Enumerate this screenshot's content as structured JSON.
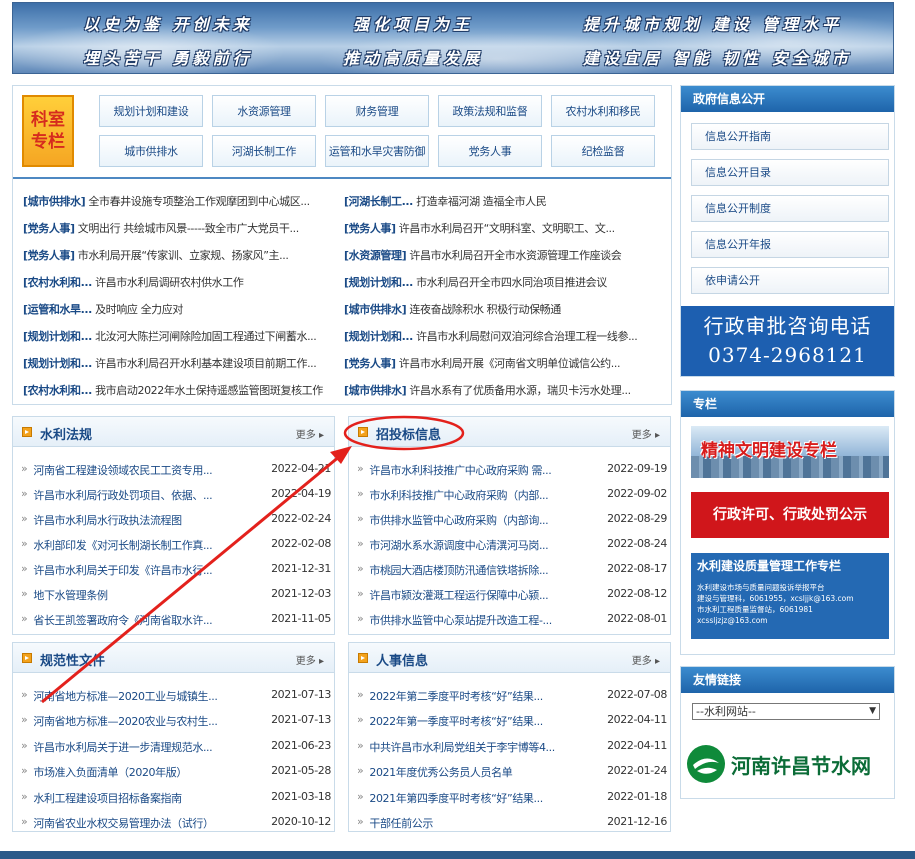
{
  "banner": {
    "slogans": [
      "以史为鉴 开创未来",
      "强化项目为王",
      "提升城市规划 建设 管理水平",
      "埋头苦干 勇毅前行",
      "推动高质量发展",
      "建设宜居 智能 韧性 安全城市"
    ]
  },
  "departments": {
    "badge": [
      "科室",
      "专栏"
    ],
    "buttons": [
      "规划计划和建设",
      "水资源管理",
      "财务管理",
      "政策法规和监督",
      "农村水利和移民",
      "城市供排水",
      "河湖长制工作",
      "运管和水旱灾害防御",
      "党务人事",
      "纪检监督"
    ]
  },
  "news": {
    "left": [
      {
        "cat": "[城市供排水]",
        "title": "全市春井设施专项整治工作观摩团到中心城区..."
      },
      {
        "cat": "[党务人事]",
        "title": "文明出行 共绘城市风景-----致全市广大党员干..."
      },
      {
        "cat": "[党务人事]",
        "title": "市水利局开展“传家训、立家规、扬家风”主..."
      },
      {
        "cat": "[农村水利和...",
        "title": "许昌市水利局调研农村供水工作"
      },
      {
        "cat": "[运管和水旱...",
        "title": "及时响应 全力应对"
      },
      {
        "cat": "[规划计划和...",
        "title": "北汝河大陈拦河闸除险加固工程通过下闸蓄水..."
      },
      {
        "cat": "[规划计划和...",
        "title": "许昌市水利局召开水利基本建设项目前期工作..."
      },
      {
        "cat": "[农村水利和...",
        "title": "我市启动2022年水土保持遥感监管图斑复核工作"
      }
    ],
    "right": [
      {
        "cat": "[河湖长制工...",
        "title": "打造幸福河湖 造福全市人民"
      },
      {
        "cat": "[党务人事]",
        "title": "许昌市水利局召开“文明科室、文明职工、文..."
      },
      {
        "cat": "[水资源管理]",
        "title": "许昌市水利局召开全市水资源管理工作座谈会"
      },
      {
        "cat": "[规划计划和...",
        "title": "市水利局召开全市四水同治项目推进会议"
      },
      {
        "cat": "[城市供排水]",
        "title": "连夜奋战除积水 积极行动保畅通"
      },
      {
        "cat": "[规划计划和...",
        "title": "许昌市水利局慰问双洎河综合治理工程一线参..."
      },
      {
        "cat": "[党务人事]",
        "title": "许昌市水利局开展《河南省文明单位诚信公约..."
      },
      {
        "cat": "[城市供排水]",
        "title": "许昌水系有了优质备用水源，瑞贝卡污水处理..."
      }
    ]
  },
  "panels": {
    "laws": {
      "title": "水利法规",
      "more": "更多",
      "items": [
        {
          "title": "河南省工程建设领域农民工工资专用...",
          "date": "2022-04-21"
        },
        {
          "title": "许昌市水利局行政处罚项目、依据、...",
          "date": "2022-04-19"
        },
        {
          "title": "许昌市水利局水行政执法流程图",
          "date": "2022-02-24"
        },
        {
          "title": "水利部印发《对河长制湖长制工作真...",
          "date": "2022-02-08"
        },
        {
          "title": "许昌市水利局关于印发《许昌市水行...",
          "date": "2021-12-31"
        },
        {
          "title": "地下水管理条例",
          "date": "2021-12-03"
        },
        {
          "title": "省长王凯签署政府令《河南省取水许...",
          "date": "2021-11-05"
        }
      ]
    },
    "tender": {
      "title": "招投标信息",
      "more": "更多",
      "items": [
        {
          "title": "许昌市水利科技推广中心政府采购 需...",
          "date": "2022-09-19"
        },
        {
          "title": "市水利科技推广中心政府采购（内部...",
          "date": "2022-09-02"
        },
        {
          "title": "市供排水监管中心政府采购（内部询...",
          "date": "2022-08-29"
        },
        {
          "title": "市河湖水系水源调度中心清潩河马岗...",
          "date": "2022-08-24"
        },
        {
          "title": "市桃园大酒店楼顶防汛通信铁塔拆除...",
          "date": "2022-08-17"
        },
        {
          "title": "许昌市颍汝灌溉工程运行保障中心颍...",
          "date": "2022-08-12"
        },
        {
          "title": "市供排水监管中心泵站提升改造工程-...",
          "date": "2022-08-01"
        }
      ]
    },
    "norms": {
      "title": "规范性文件",
      "more": "更多",
      "items": [
        {
          "title": "河南省地方标准—2020工业与城镇生...",
          "date": "2021-07-13"
        },
        {
          "title": "河南省地方标准—2020农业与农村生...",
          "date": "2021-07-13"
        },
        {
          "title": "许昌市水利局关于进一步清理规范水...",
          "date": "2021-06-23"
        },
        {
          "title": "市场准入负面清单（2020年版）",
          "date": "2021-05-28"
        },
        {
          "title": "水利工程建设项目招标备案指南",
          "date": "2021-03-18"
        },
        {
          "title": "河南省农业水权交易管理办法（试行）",
          "date": "2020-10-12"
        }
      ]
    },
    "personnel": {
      "title": "人事信息",
      "more": "更多",
      "items": [
        {
          "title": "2022年第二季度平时考核“好”结果...",
          "date": "2022-07-08"
        },
        {
          "title": "2022年第一季度平时考核“好”结果...",
          "date": "2022-04-11"
        },
        {
          "title": "中共许昌市水利局党组关于李宇博等4...",
          "date": "2022-04-11"
        },
        {
          "title": "2021年度优秀公务员人员名单",
          "date": "2022-01-24"
        },
        {
          "title": "2021年第四季度平时考核“好”结果...",
          "date": "2022-01-18"
        },
        {
          "title": "干部任前公示",
          "date": "2021-12-16"
        }
      ]
    }
  },
  "sidebar": {
    "gov": {
      "title": "政府信息公开",
      "items": [
        "信息公开指南",
        "信息公开目录",
        "信息公开制度",
        "信息公开年报",
        "依申请公开"
      ]
    },
    "hotline": {
      "line1": "行政审批咨询电话",
      "line2": "0374-2968121"
    },
    "special": {
      "title": "专栏",
      "b1": "精神文明建设专栏",
      "b2": "行政许可、行政处罚公示",
      "b3": {
        "title": "水利建设质量管理工作专栏",
        "lines": [
          "水利建设市场与质量问题投诉举报平台",
          "建设与管理科，6061955，xcsljjk@163.com",
          "市水利工程质量监督站，6061981",
          "xcssljzjz@163.com"
        ]
      }
    },
    "links": {
      "title": "友情链接",
      "select": "--水利网站--",
      "logo_text": "河南许昌节水网"
    }
  },
  "colors": {
    "accent": "#1a4a86",
    "header": "#1e64aa",
    "annotation": "#e3211c"
  }
}
